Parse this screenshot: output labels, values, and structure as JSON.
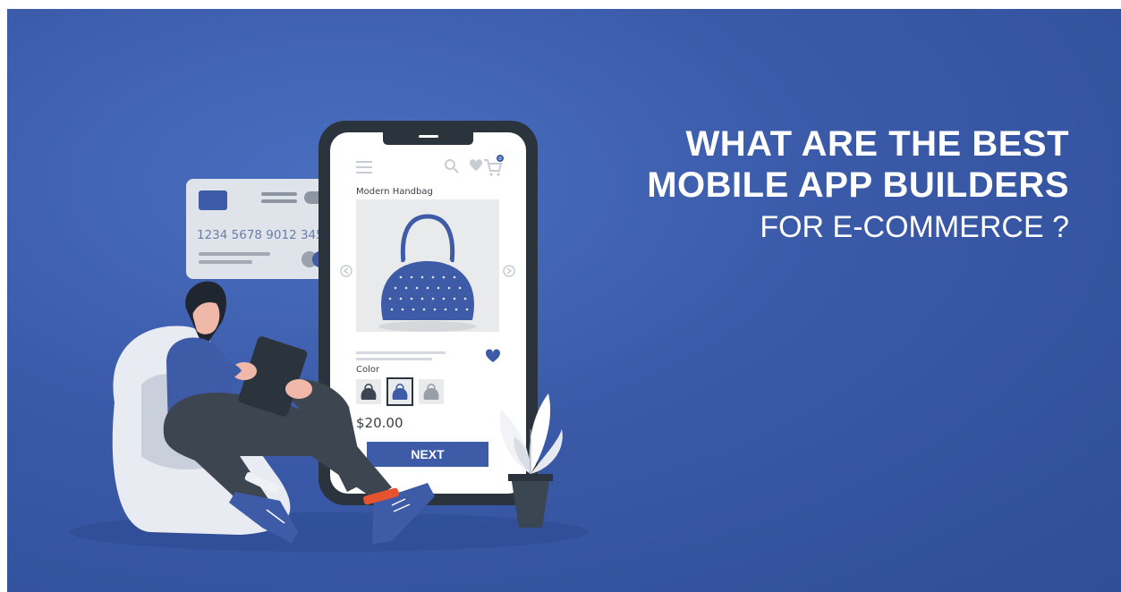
{
  "headline": {
    "line1": "WHAT ARE THE BEST",
    "line2": "MOBILE APP BUILDERS",
    "line3": "FOR E-COMMERCE ?"
  },
  "card": {
    "number": "1234 5678 9012 345"
  },
  "phone": {
    "product_name": "Modern Handbag",
    "color_label": "Color",
    "price": "$20.00",
    "next_button": "NEXT",
    "cart_count": "0"
  },
  "colors": {
    "background": "#3a5aa8",
    "accent": "#3e5ba8",
    "phone_frame": "#2b333c"
  }
}
